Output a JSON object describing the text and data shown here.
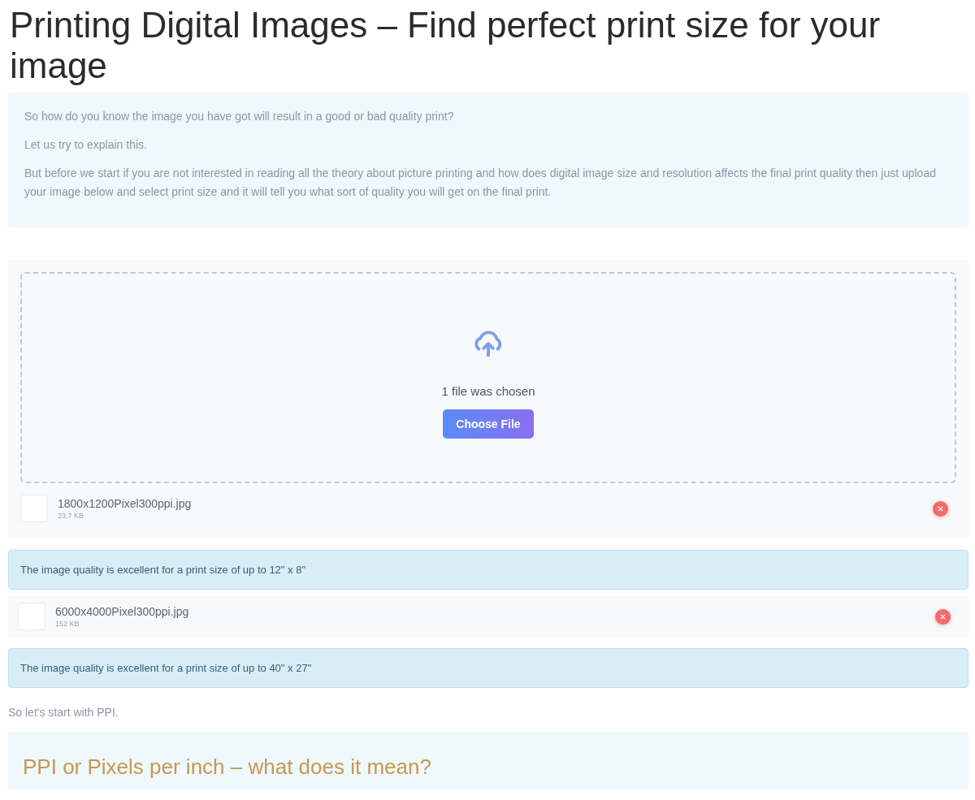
{
  "title": "Printing Digital Images – Find perfect print size for your image",
  "intro": [
    "So how do you know the image you have got will result in a good or bad quality print?",
    "Let us try to explain this.",
    "But before we start if you are not interested in reading all the theory about picture printing and how does digital image size and resolution affects the final print quality then just upload your image below and select print size and it will tell you what sort of quality you will get on the final print."
  ],
  "uploader": {
    "status": "1 file was chosen",
    "button": "Choose File"
  },
  "files": [
    {
      "name": "1800x1200Pixel300ppi.jpg",
      "size": "23.7 KB",
      "result": "The image quality is excellent for a print size of up to 12\" x 8\""
    },
    {
      "name": "6000x4000Pixel300ppi.jpg",
      "size": "152 KB",
      "result": "The image quality is excellent for a print size of up to 40\" x 27\""
    }
  ],
  "after_text": "So let's start with PPI.",
  "section": {
    "heading": "PPI or Pixels per inch – what does it mean?"
  }
}
